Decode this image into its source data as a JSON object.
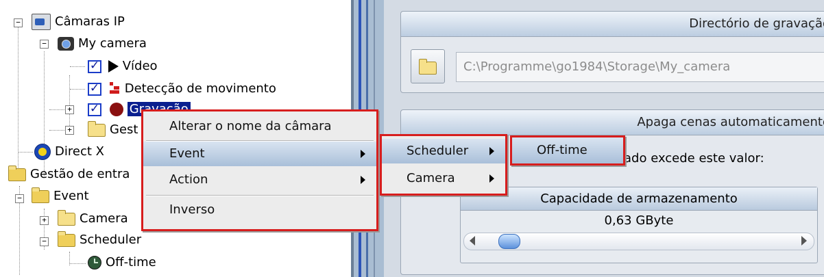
{
  "tree": {
    "items": [
      {
        "label": "Câmaras IP",
        "icon": "ip-cameras-icon"
      },
      {
        "label": "My camera",
        "icon": "camera-icon"
      },
      {
        "label": "Vídeo",
        "icon": "play-icon",
        "checked": true
      },
      {
        "label": "Detecção de movimento",
        "icon": "motion-detection-icon",
        "checked": true
      },
      {
        "label": "Gravação",
        "icon": "record-icon",
        "checked": true,
        "selected": true
      },
      {
        "label": "Gest",
        "icon": "folder-icon"
      },
      {
        "label": "Direct X",
        "icon": "directx-icon"
      },
      {
        "label": "Gestão de entra",
        "icon": "folder-open-icon"
      },
      {
        "label": "Event",
        "icon": "folder-open-icon"
      },
      {
        "label": "Camera",
        "icon": "folder-icon"
      },
      {
        "label": "Scheduler",
        "icon": "folder-open-icon"
      },
      {
        "label": "Off-time",
        "icon": "clock-icon"
      }
    ]
  },
  "right": {
    "recording_dir": {
      "title": "Directório de gravação",
      "path_value": "C:\\Programme\\go1984\\Storage\\My_camera"
    },
    "auto_delete": {
      "title": "Apaga cenas automaticamente",
      "text": "ado excede este valor:"
    },
    "storage": {
      "title": "Capacidade de armazenamento",
      "value": "0,63 GByte",
      "slider_fraction": 0.06
    }
  },
  "menu_main": {
    "items": [
      {
        "label": "Alterar o nome da câmara",
        "submenu": false
      },
      {
        "label": "Event",
        "submenu": true
      },
      {
        "label": "Action",
        "submenu": true
      },
      {
        "label": "Inverso",
        "submenu": false
      }
    ]
  },
  "menu_event": {
    "items": [
      {
        "label": "Scheduler",
        "submenu": true
      },
      {
        "label": "Camera",
        "submenu": true
      }
    ]
  },
  "menu_scheduler": {
    "items": [
      {
        "label": "Off-time",
        "submenu": false
      }
    ]
  },
  "colors": {
    "highlight_border": "#d71d1d",
    "selection": "#0a1f8f"
  }
}
